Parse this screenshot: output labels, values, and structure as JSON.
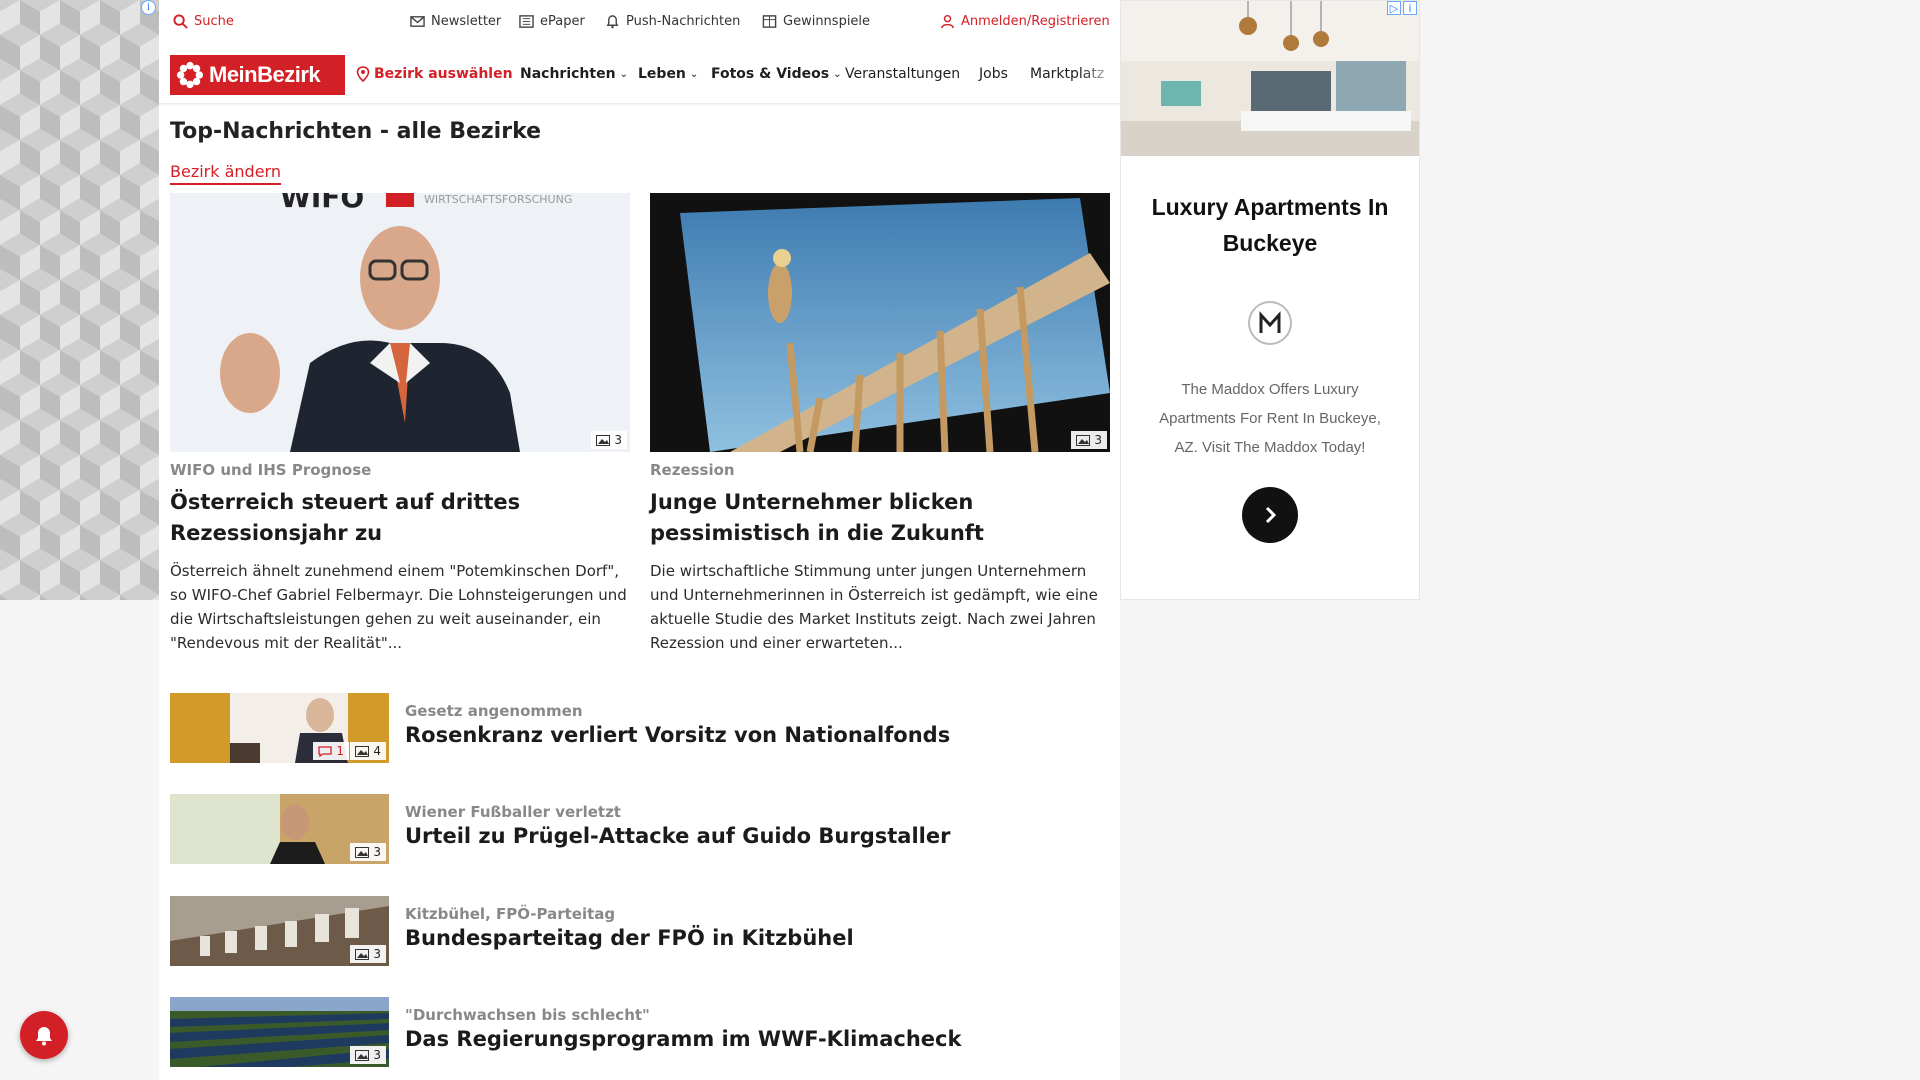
{
  "topbar": {
    "search": "Suche",
    "newsletter": "Newsletter",
    "epaper": "ePaper",
    "push": "Push-Nachrichten",
    "games": "Gewinnspiele",
    "login": "Anmelden/Registrieren"
  },
  "nav": {
    "logo": "MeinBezirk",
    "district": "Bezirk auswählen",
    "items": [
      "Nachrichten",
      "Leben",
      "Fotos & Videos",
      "Veranstaltungen",
      "Jobs",
      "Marktplatz"
    ]
  },
  "page": {
    "title": "Top-Nachrichten - alle Bezirke",
    "change_district": "Bezirk ändern"
  },
  "top_stories": [
    {
      "kicker": "WIFO und IHS Prognose",
      "headline": "Österreich steuert auf drittes Rezessionsjahr zu",
      "teaser": "Österreich ähnelt zunehmend einem \"Potemkinschen Dorf\", so WIFO-Chef Gabriel Felbermayr. Die Lohnsteigerungen und die Wirtschaftsleistungen gehen zu weit auseinander, ein \"Rendevous mit der Realität\"...",
      "images": "3",
      "img_text": "WIFO",
      "img_subtext": "WIRTSCHAFTSFORSCHUNG"
    },
    {
      "kicker": "Rezession",
      "headline": "Junge Unternehmer blicken pessimistisch in die Zukunft",
      "teaser": "Die wirtschaftliche Stimmung unter jungen Unternehmern und Unternehmerinnen in Österreich ist gedämpft, wie eine aktuelle Studie des Market Instituts zeigt. Nach zwei Jahren Rezession und einer erwarteten...",
      "images": "3"
    }
  ],
  "list_stories": [
    {
      "kicker": "Gesetz angenommen",
      "headline": "Rosenkranz verliert Vorsitz von Nationalfonds",
      "comments": "1",
      "images": "4"
    },
    {
      "kicker": "Wiener Fußballer verletzt",
      "headline": "Urteil zu Prügel-Attacke auf Guido Burgstaller",
      "images": "3"
    },
    {
      "kicker": "Kitzbühel, FPÖ-Parteitag",
      "headline": "Bundesparteitag der FPÖ in Kitzbühel",
      "images": "3"
    },
    {
      "kicker": "\"Durchwachsen bis schlecht\"",
      "headline": "Das Regierungsprogramm im WWF-Klimacheck",
      "images": "3"
    }
  ],
  "ad": {
    "title": "Luxury Apartments In Buckeye",
    "text": "The Maddox Offers Luxury Apartments For Rent In Buckeye, AZ. Visit The Maddox Today!",
    "info_icon": "info-icon",
    "adchoices_icon": "adchoices-icon"
  },
  "colors": {
    "brand_red": "#d31f26",
    "text_dark": "#1b1b1b",
    "kicker_gray": "#888888"
  }
}
